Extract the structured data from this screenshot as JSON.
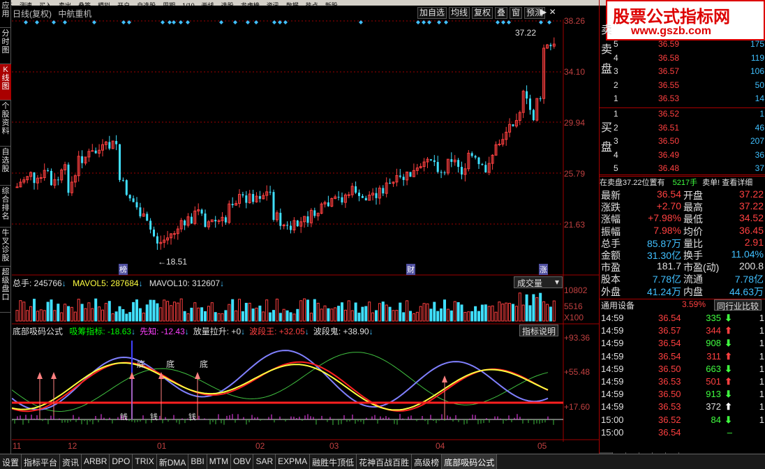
{
  "menubar": [
    "修正",
    "测速",
    "买入",
    "卖出",
    "叠签",
    "模拟",
    "开户",
    "自选股",
    "周期",
    "1/10",
    "画线",
    "选股",
    "龙虎榜",
    "资讯",
    "数据",
    "热点",
    "新股"
  ],
  "left_toolbar": [
    "应用",
    "分时图",
    "K线图",
    "个股资料",
    "自选股",
    "综合排名",
    "牛叉诊股",
    "超级盘口"
  ],
  "chart": {
    "title": "日线(复权)",
    "name": "中航重机"
  },
  "toolbar": [
    "加自选",
    "均线",
    "复权",
    "叠",
    "窗",
    "预测"
  ],
  "logo": {
    "text": "股票公式指标网",
    "url": "www.gszb.com"
  },
  "price_axis": [
    "38.26",
    "34.10",
    "29.94",
    "25.79",
    "21.63"
  ],
  "last_price": "37.22",
  "low_label": "18.51",
  "markers": [
    "榜",
    "财",
    "涨"
  ],
  "volume": {
    "total_label": "总手: 245766",
    "mavol5": "MAVOL5: 287684",
    "mavol10": "MAVOL10: 312607",
    "dropdown": "成交量",
    "axis": [
      "10802",
      "5516",
      "X100"
    ]
  },
  "indicator": {
    "name": "底部吸码公式",
    "tooltip_btn": "指标说明",
    "items": [
      {
        "label": "吸筹指标: -18.63",
        "color": "#00ff00"
      },
      {
        "label": "先知: -12.43",
        "color": "#ff40ff"
      },
      {
        "label": "放量拉升: +0",
        "color": "#e0e0e0"
      },
      {
        "label": "波段王: +32.05",
        "color": "#ff4040"
      },
      {
        "label": "波段鬼: +38.90",
        "color": "#e0e0e0"
      }
    ],
    "axis": [
      "+93.36",
      "+55.48",
      "+17.60"
    ],
    "bottom_text": [
      "底",
      "底",
      "底"
    ],
    "tags": [
      "钱",
      "钱",
      "钱"
    ]
  },
  "x_axis": [
    "11",
    "12",
    "01",
    "02",
    "03",
    "04",
    "05"
  ],
  "orderbook": {
    "sell": [
      {
        "n": "5",
        "p": "36.59",
        "v": "175"
      },
      {
        "n": "4",
        "p": "36.58",
        "v": "119"
      },
      {
        "n": "3",
        "p": "36.57",
        "v": "106"
      },
      {
        "n": "2",
        "p": "36.55",
        "v": "50"
      },
      {
        "n": "1",
        "p": "36.53",
        "v": "14"
      }
    ],
    "buy": [
      {
        "n": "1",
        "p": "36.52",
        "v": "1"
      },
      {
        "n": "2",
        "p": "36.51",
        "v": "46"
      },
      {
        "n": "3",
        "p": "36.50",
        "v": "207"
      },
      {
        "n": "4",
        "p": "36.49",
        "v": "36"
      },
      {
        "n": "5",
        "p": "36.48",
        "v": "37"
      }
    ],
    "sell_label": "卖盘",
    "buy_label": "买盘",
    "sell_head": "卖"
  },
  "notice": {
    "left": "在卖盘37.22位置有",
    "qty": "5217手",
    "right": "卖单! 查看详细"
  },
  "stats": [
    {
      "l1": "最新",
      "v1": "36.54",
      "l2": "开盘",
      "v2": "37.22"
    },
    {
      "l1": "涨跌",
      "v1": "+2.70",
      "l2": "最高",
      "v2": "37.22"
    },
    {
      "l1": "涨幅",
      "v1": "+7.98%",
      "l2": "最低",
      "v2": "34.52"
    },
    {
      "l1": "振幅",
      "v1": "7.98%",
      "l2": "均价",
      "v2": "36.45"
    },
    {
      "l1": "总手",
      "v1": "85.87万",
      "l2": "量比",
      "v2": "2.91"
    },
    {
      "l1": "金额",
      "v1": "31.30亿",
      "l2": "换手",
      "v2": "11.04%"
    },
    {
      "l1": "市盈",
      "v1": "181.7",
      "l2": "市盈(动)",
      "v2": "200.8"
    },
    {
      "l1": "股本",
      "v1": "7.78亿",
      "l2": "流通",
      "v2": "7.78亿"
    },
    {
      "l1": "外盘",
      "v1": "41.24万",
      "l2": "内盘",
      "v2": "44.63万"
    }
  ],
  "industry": {
    "name": "通用设备",
    "pct": "3.59%",
    "btn": "同行业比较"
  },
  "ticks": [
    {
      "t": "14:59",
      "p": "36.54",
      "v": "335",
      "d": "down",
      "e": "1"
    },
    {
      "t": "14:59",
      "p": "36.57",
      "v": "344",
      "d": "up",
      "e": "1"
    },
    {
      "t": "14:59",
      "p": "36.54",
      "v": "908",
      "d": "down",
      "e": "1"
    },
    {
      "t": "14:59",
      "p": "36.54",
      "v": "311",
      "d": "up",
      "e": "1"
    },
    {
      "t": "14:59",
      "p": "36.50",
      "v": "663",
      "d": "down",
      "e": "1"
    },
    {
      "t": "14:59",
      "p": "36.53",
      "v": "501",
      "d": "up",
      "e": "1"
    },
    {
      "t": "14:59",
      "p": "36.50",
      "v": "913",
      "d": "down",
      "e": "1"
    },
    {
      "t": "14:59",
      "p": "36.53",
      "v": "372",
      "d": "flat",
      "e": "1"
    },
    {
      "t": "15:00",
      "p": "36.52",
      "v": "84",
      "d": "down",
      "e": "1"
    },
    {
      "t": "15:00",
      "p": "36.54",
      "v": "",
      "d": "none",
      "e": ""
    }
  ],
  "tabs": [
    "设置",
    "指标平台",
    "资讯",
    "ARBR",
    "DPO",
    "TRIX",
    "新DMA",
    "BBI",
    "MTM",
    "OBV",
    "SAR",
    "EXPMA",
    "融胜牛顶低",
    "花神百战百胜",
    "高级榜",
    "底部吸码公式"
  ],
  "right_tabs": [
    "细",
    "诊",
    "分",
    "筹",
    "指",
    "财"
  ]
}
